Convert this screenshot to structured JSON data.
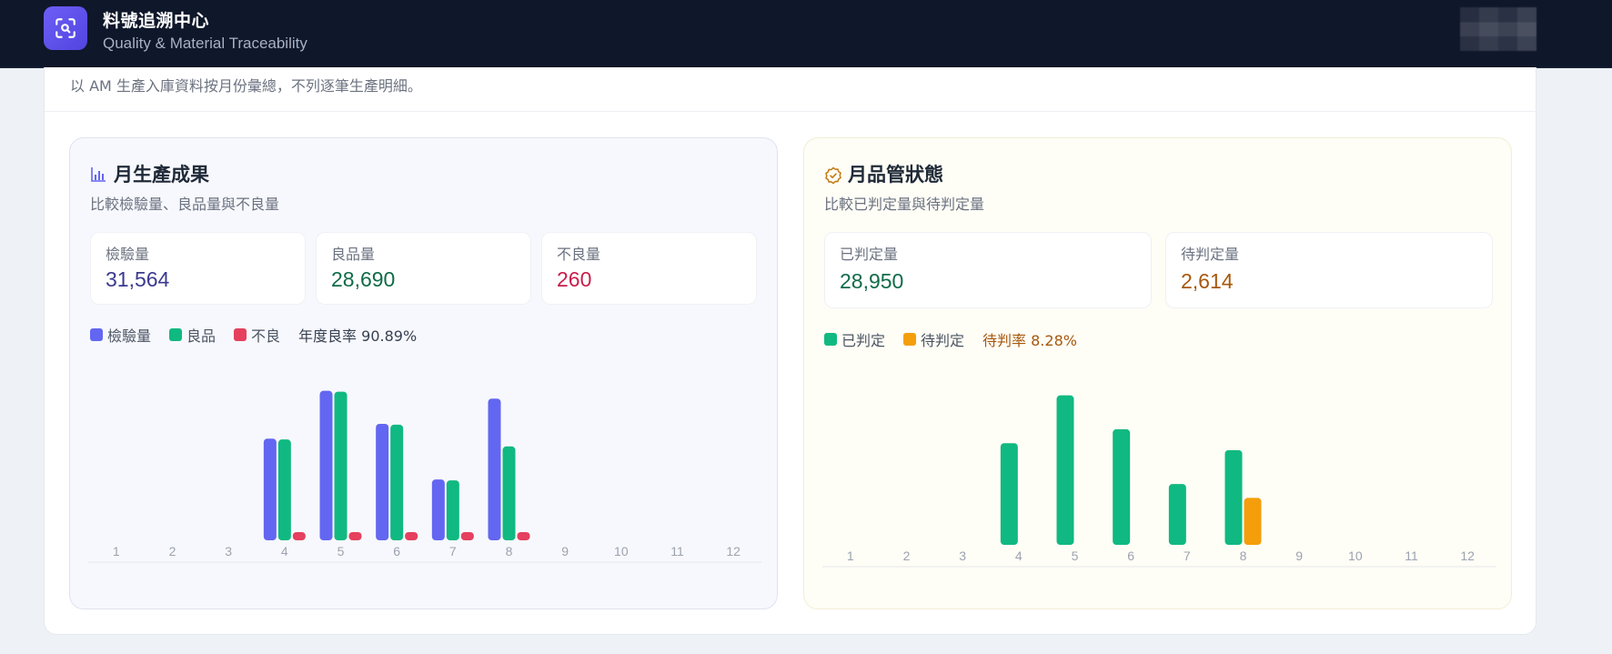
{
  "header": {
    "title": "料號追溯中心",
    "subtitle": "Quality & Material Traceability"
  },
  "note": "以 AM 生產入庫資料按月份彙總，不列逐筆生產明細。",
  "production": {
    "title": "月生產成果",
    "subtitle": "比較檢驗量、良品量與不良量",
    "stats": [
      {
        "label": "檢驗量",
        "value": "31,564",
        "color": "#3b3a8f"
      },
      {
        "label": "良品量",
        "value": "28,690",
        "color": "#0f6b48"
      },
      {
        "label": "不良量",
        "value": "260",
        "color": "#c81e4a"
      }
    ],
    "legend": [
      {
        "label": "檢驗量",
        "color": "#6366f1"
      },
      {
        "label": "良品",
        "color": "#10b981"
      },
      {
        "label": "不良",
        "color": "#e5405e"
      }
    ],
    "rate_label": "年度良率 90.89%"
  },
  "quality": {
    "title": "月品管狀態",
    "subtitle": "比較已判定量與待判定量",
    "stats": [
      {
        "label": "已判定量",
        "value": "28,950",
        "color": "#0f6b48"
      },
      {
        "label": "待判定量",
        "value": "2,614",
        "color": "#a6580d"
      }
    ],
    "legend": [
      {
        "label": "已判定",
        "color": "#10b981"
      },
      {
        "label": "待判定",
        "color": "#f59e0b"
      }
    ],
    "rate_label": "待判率 8.28%"
  },
  "chart_data": [
    {
      "type": "bar",
      "categories": [
        "1",
        "2",
        "3",
        "4",
        "5",
        "6",
        "7",
        "8",
        "9",
        "10",
        "11",
        "12"
      ],
      "series": [
        {
          "name": "檢驗量",
          "color": "#6366f1",
          "values": [
            0,
            0,
            0,
            5850,
            8600,
            6700,
            3500,
            8150,
            0,
            0,
            0,
            0
          ]
        },
        {
          "name": "良品",
          "color": "#10b981",
          "values": [
            0,
            0,
            0,
            5800,
            8550,
            6650,
            3450,
            5400,
            0,
            0,
            0,
            0
          ]
        },
        {
          "name": "不良",
          "color": "#e5405e",
          "values": [
            0,
            0,
            0,
            45,
            55,
            50,
            45,
            65,
            0,
            0,
            0,
            0
          ]
        }
      ],
      "ylim": [
        0,
        9000
      ],
      "grid": false
    },
    {
      "type": "bar",
      "categories": [
        "1",
        "2",
        "3",
        "4",
        "5",
        "6",
        "7",
        "8",
        "9",
        "10",
        "11",
        "12"
      ],
      "series": [
        {
          "name": "已判定",
          "color": "#10b981",
          "values": [
            0,
            0,
            0,
            5850,
            8600,
            6650,
            3500,
            5450,
            0,
            0,
            0,
            0
          ]
        },
        {
          "name": "待判定",
          "color": "#f59e0b",
          "values": [
            0,
            0,
            0,
            0,
            0,
            0,
            0,
            2700,
            0,
            0,
            0,
            0
          ]
        }
      ],
      "ylim": [
        0,
        9000
      ],
      "grid": false
    }
  ]
}
